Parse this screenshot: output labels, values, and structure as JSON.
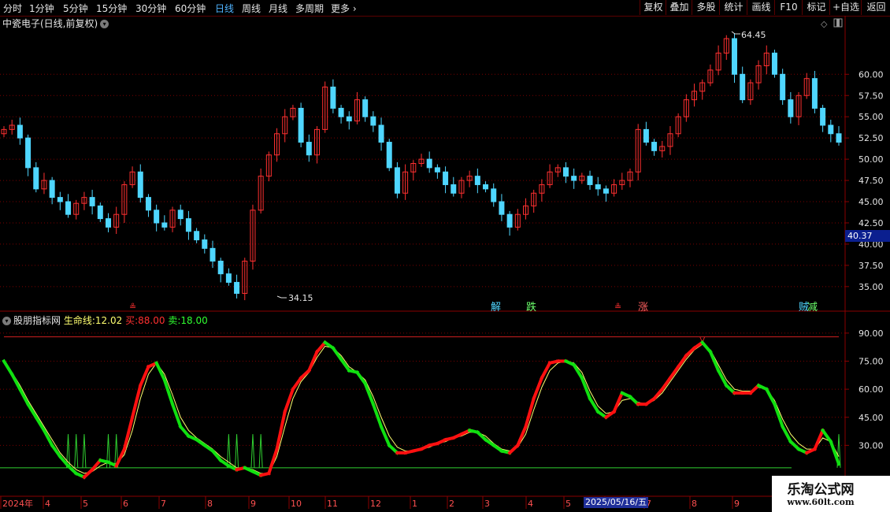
{
  "toolbar": {
    "periods": [
      "分时",
      "1分钟",
      "5分钟",
      "15分钟",
      "30分钟",
      "60分钟",
      "日线",
      "周线",
      "月线",
      "多周期",
      "更多"
    ],
    "active_period": "日线",
    "right_buttons": [
      "复权",
      "叠加",
      "多股",
      "统计",
      "画线",
      "F10",
      "标记",
      "+自选",
      "返回"
    ]
  },
  "stock": {
    "name": "中瓷电子",
    "title": "中瓷电子(日线,前复权)"
  },
  "price_axis": {
    "ticks": [
      "60.00",
      "57.50",
      "55.00",
      "52.50",
      "50.00",
      "47.50",
      "45.00",
      "42.50",
      "40.00",
      "37.50",
      "35.00"
    ],
    "current_price": "40.37",
    "high_label": "64.45",
    "low_label": "34.15"
  },
  "signals": {
    "lock_marker": "≗",
    "jie": "解",
    "die": "跌",
    "zhang": "涨",
    "zei": "贼",
    "jian": "减"
  },
  "indicator": {
    "name": "股朋指标网",
    "lifeline_label": "生命线:",
    "lifeline_value": "12.02",
    "buy_label": "买:",
    "buy_value": "88.00",
    "sell_label": "卖:",
    "sell_value": "18.00",
    "ticks": [
      "90.00",
      "75.00",
      "60.00",
      "45.00",
      "30.00"
    ]
  },
  "time_axis": {
    "labels": [
      "2024年",
      "4",
      "5",
      "6",
      "7",
      "8",
      "9",
      "10",
      "11",
      "12",
      "1",
      "2",
      "3",
      "4",
      "5",
      "6",
      "7",
      "8",
      "9"
    ],
    "cursor_date": "2025/05/16/五"
  },
  "watermark": {
    "title": "乐淘公式网",
    "url": "www.60lt.com"
  },
  "colors": {
    "up": "#ff3030",
    "down": "#4fd6ff",
    "indicator_up": "#ff1010",
    "indicator_down": "#10e010",
    "lifeline": "#ffff70",
    "grid": "#7a0000"
  },
  "chart_data": [
    {
      "type": "candlestick",
      "title": "中瓷电子(日线,前复权)",
      "ylim": [
        33.5,
        65.5
      ],
      "series_close": [
        53.5,
        54.0,
        52.5,
        49.0,
        46.5,
        47.5,
        45.5,
        45.0,
        43.5,
        44.8,
        45.5,
        44.5,
        43.0,
        42.0,
        43.5,
        47.0,
        48.5,
        45.5,
        44.0,
        42.5,
        42.0,
        44.0,
        43.0,
        41.5,
        40.5,
        39.5,
        38.0,
        36.5,
        35.5,
        34.2,
        38.0,
        44.0,
        48.0,
        50.5,
        53.0,
        55.0,
        56.0,
        52.0,
        50.5,
        53.5,
        58.5,
        56.0,
        55.0,
        54.5,
        57.0,
        55.0,
        54.0,
        52.0,
        49.0,
        46.0,
        48.5,
        49.5,
        50.0,
        49.0,
        48.5,
        47.0,
        46.0,
        47.5,
        48.0,
        47.0,
        46.5,
        45.0,
        43.5,
        42.0,
        43.5,
        44.5,
        46.0,
        47.0,
        48.5,
        49.0,
        48.0,
        47.5,
        48.0,
        47.0,
        46.5,
        46.0,
        47.0,
        47.5,
        48.5,
        53.5,
        52.0,
        51.0,
        51.5,
        53.0,
        55.0,
        57.0,
        58.0,
        59.0,
        60.5,
        62.5,
        64.2,
        60.0,
        57.0,
        59.0,
        61.0,
        62.5,
        60.0,
        57.0,
        55.0,
        57.5,
        59.5,
        56.0,
        54.0,
        53.0,
        52.0
      ]
    },
    {
      "type": "line",
      "title": "股朋指标网",
      "ylim": [
        15,
        95
      ],
      "series": [
        {
          "name": "生命线",
          "values": [
            75,
            68,
            60,
            52,
            45,
            38,
            30,
            24,
            19,
            15,
            13,
            17,
            22,
            21,
            19,
            28,
            45,
            62,
            72,
            74,
            65,
            52,
            40,
            35,
            33,
            30,
            27,
            22,
            19,
            17,
            18,
            16,
            14,
            15,
            28,
            48,
            60,
            66,
            70,
            80,
            85,
            82,
            76,
            70,
            69,
            63,
            52,
            40,
            30,
            26,
            26,
            27,
            28,
            30,
            31,
            33,
            34,
            36,
            38,
            37,
            33,
            30,
            27,
            26,
            30,
            40,
            55,
            66,
            74,
            75,
            75,
            73,
            66,
            55,
            48,
            45,
            48,
            58,
            56,
            52,
            52,
            55,
            60,
            66,
            72,
            78,
            82,
            85,
            80,
            70,
            62,
            58,
            58,
            58,
            62,
            60,
            52,
            40,
            32,
            28,
            26,
            28,
            38,
            32,
            20
          ]
        },
        {
          "name": "信号",
          "values": [
            75,
            69,
            62,
            54,
            47,
            40,
            33,
            26,
            21,
            17,
            15,
            16,
            19,
            21,
            20,
            25,
            38,
            55,
            68,
            74,
            68,
            57,
            45,
            38,
            34,
            31,
            28,
            24,
            21,
            18,
            18,
            17,
            15,
            15,
            24,
            40,
            55,
            64,
            69,
            77,
            83,
            82,
            78,
            72,
            69,
            65,
            56,
            45,
            35,
            29,
            27,
            27,
            28,
            29,
            31,
            32,
            34,
            35,
            37,
            37,
            35,
            31,
            28,
            27,
            29,
            36,
            49,
            61,
            70,
            74,
            75,
            74,
            69,
            59,
            51,
            47,
            48,
            54,
            55,
            53,
            52,
            54,
            58,
            64,
            70,
            76,
            81,
            84,
            81,
            73,
            65,
            60,
            59,
            59,
            61,
            60,
            54,
            44,
            36,
            31,
            28,
            28,
            34,
            32,
            24
          ]
        }
      ],
      "buy": 88.0,
      "sell": 18.0
    }
  ]
}
